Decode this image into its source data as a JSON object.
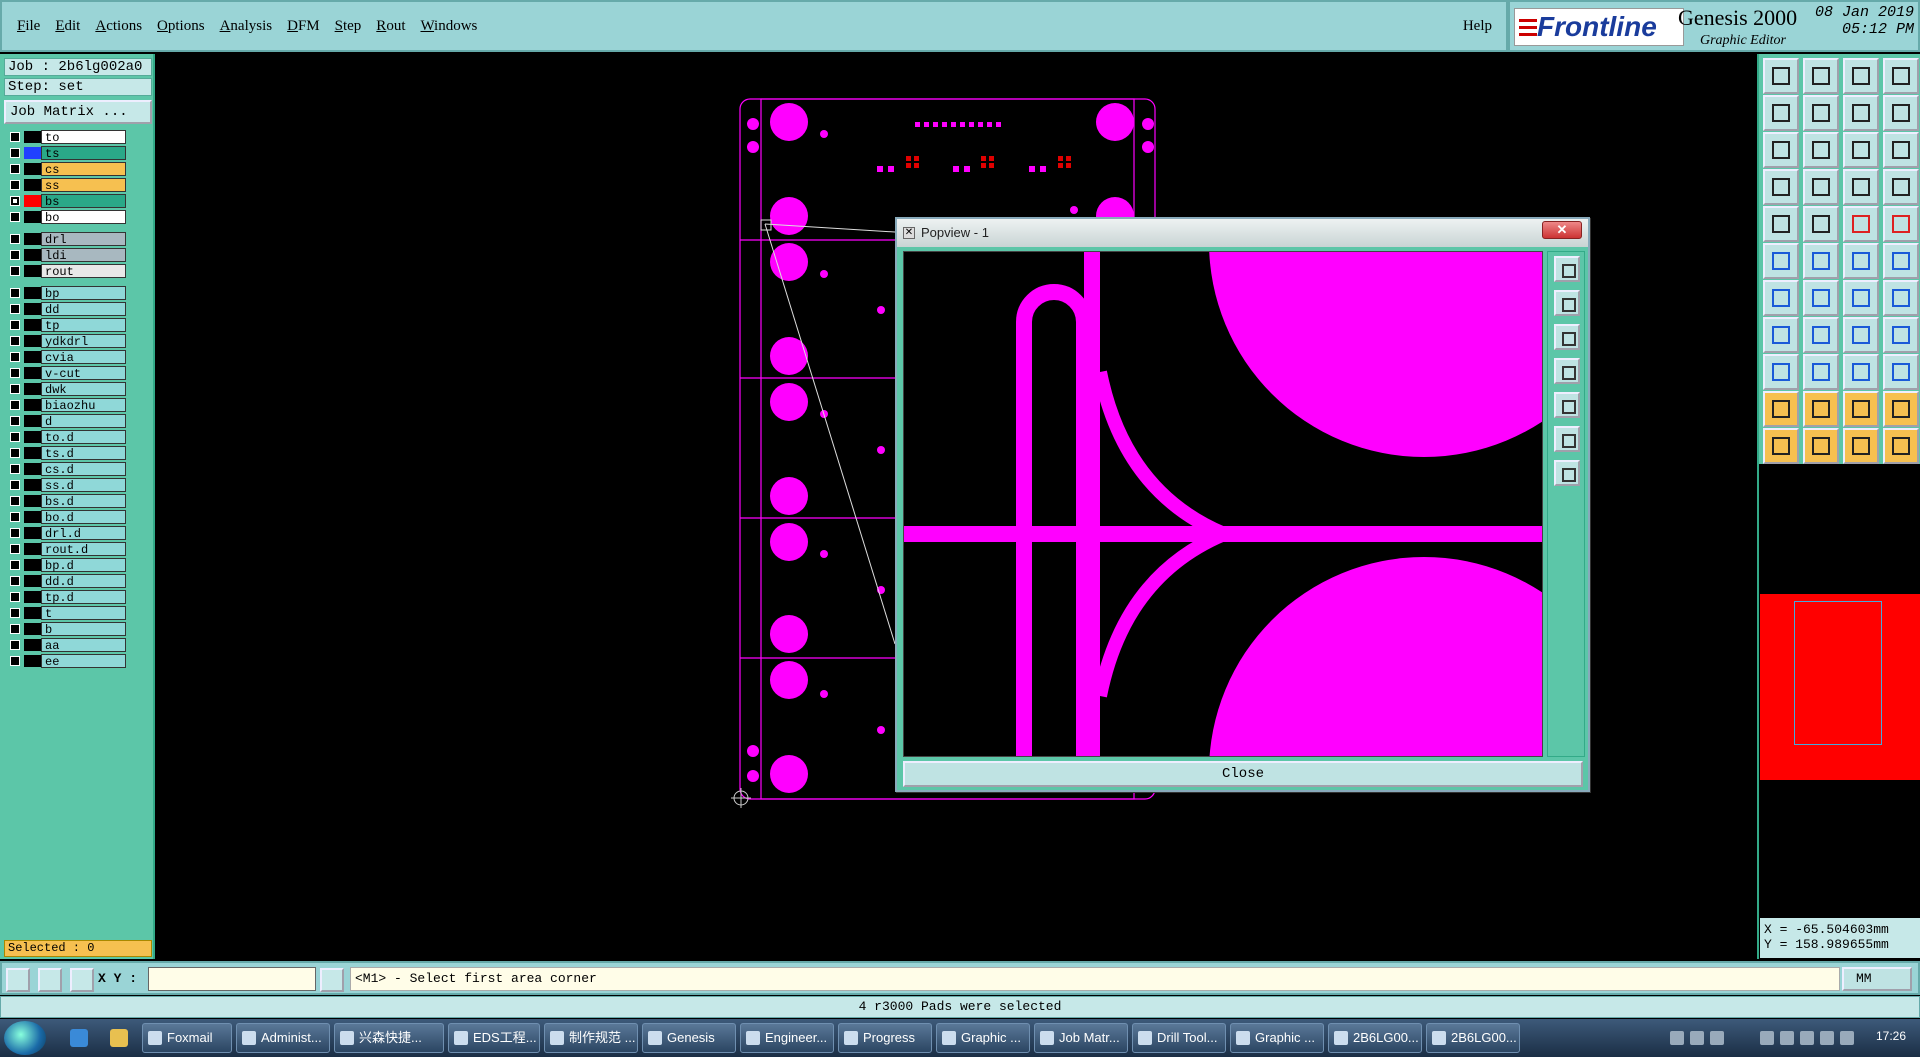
{
  "menu": {
    "items": [
      "File",
      "Edit",
      "Actions",
      "Options",
      "Analysis",
      "DFM",
      "Step",
      "Rout",
      "Windows"
    ],
    "help": "Help"
  },
  "brand": {
    "logo": "Frontline",
    "product": "Genesis 2000",
    "subtitle": "Graphic Editor",
    "date": "08 Jan 2019",
    "time": "05:12 PM"
  },
  "job": {
    "job_label": "Job : 2b6lg002a0",
    "step_label": "Step: set",
    "matrix_button": "Job Matrix ..."
  },
  "layers": [
    {
      "name": "to",
      "bg": "#ffffff",
      "swatch": "#000000",
      "checked": false
    },
    {
      "name": "ts",
      "bg": "#2aa888",
      "swatch": "#2040ff",
      "checked": false
    },
    {
      "name": "cs",
      "bg": "#f6c050",
      "swatch": "#000000",
      "checked": false
    },
    {
      "name": "ss",
      "bg": "#f6c050",
      "swatch": "#000000",
      "checked": false
    },
    {
      "name": "bs",
      "bg": "#2aa888",
      "swatch": "#ff0000",
      "checked": true
    },
    {
      "name": "bo",
      "bg": "#ffffff",
      "swatch": "#000000",
      "checked": false
    },
    {
      "name": "drl",
      "bg": "#a8b8c0",
      "swatch": "#000000",
      "checked": false
    },
    {
      "name": "ldi",
      "bg": "#a8b8c0",
      "swatch": "#000000",
      "checked": false
    },
    {
      "name": "rout",
      "bg": "#e8e8e8",
      "swatch": "#000000",
      "checked": false
    },
    {
      "name": "bp",
      "bg": "#8fd8d8",
      "swatch": "#000000",
      "checked": false
    },
    {
      "name": "dd",
      "bg": "#8fd8d8",
      "swatch": "#000000",
      "checked": false
    },
    {
      "name": "tp",
      "bg": "#8fd8d8",
      "swatch": "#000000",
      "checked": false
    },
    {
      "name": "ydkdrl",
      "bg": "#8fd8d8",
      "swatch": "#000000",
      "checked": false
    },
    {
      "name": "cvia",
      "bg": "#8fd8d8",
      "swatch": "#000000",
      "checked": false
    },
    {
      "name": "v-cut",
      "bg": "#8fd8d8",
      "swatch": "#000000",
      "checked": false
    },
    {
      "name": "dwk",
      "bg": "#8fd8d8",
      "swatch": "#000000",
      "checked": false
    },
    {
      "name": "biaozhu",
      "bg": "#8fd8d8",
      "swatch": "#000000",
      "checked": false
    },
    {
      "name": "d",
      "bg": "#8fd8d8",
      "swatch": "#000000",
      "checked": false
    },
    {
      "name": "to.d",
      "bg": "#8fd8d8",
      "swatch": "#000000",
      "checked": false
    },
    {
      "name": "ts.d",
      "bg": "#8fd8d8",
      "swatch": "#000000",
      "checked": false
    },
    {
      "name": "cs.d",
      "bg": "#8fd8d8",
      "swatch": "#000000",
      "checked": false
    },
    {
      "name": "ss.d",
      "bg": "#8fd8d8",
      "swatch": "#000000",
      "checked": false
    },
    {
      "name": "bs.d",
      "bg": "#8fd8d8",
      "swatch": "#000000",
      "checked": false
    },
    {
      "name": "bo.d",
      "bg": "#8fd8d8",
      "swatch": "#000000",
      "checked": false
    },
    {
      "name": "drl.d",
      "bg": "#8fd8d8",
      "swatch": "#000000",
      "checked": false
    },
    {
      "name": "rout.d",
      "bg": "#8fd8d8",
      "swatch": "#000000",
      "checked": false
    },
    {
      "name": "bp.d",
      "bg": "#8fd8d8",
      "swatch": "#000000",
      "checked": false
    },
    {
      "name": "dd.d",
      "bg": "#8fd8d8",
      "swatch": "#000000",
      "checked": false
    },
    {
      "name": "tp.d",
      "bg": "#8fd8d8",
      "swatch": "#000000",
      "checked": false
    },
    {
      "name": "t",
      "bg": "#8fd8d8",
      "swatch": "#000000",
      "checked": false
    },
    {
      "name": "b",
      "bg": "#8fd8d8",
      "swatch": "#000000",
      "checked": false
    },
    {
      "name": "aa",
      "bg": "#8fd8d8",
      "swatch": "#000000",
      "checked": false
    },
    {
      "name": "ee",
      "bg": "#8fd8d8",
      "swatch": "#000000",
      "checked": false
    }
  ],
  "selected_label": "Selected : 0",
  "popview": {
    "title": "Popview - 1",
    "close_label": "Close"
  },
  "coords": {
    "x": "X = -65.504603mm",
    "y": "Y = 158.989655mm"
  },
  "status": {
    "xy_label": "X Y :",
    "xy_value": "",
    "prompt": "<M1> - Select first area corner",
    "units": "MM",
    "message": "4 r3000 Pads were selected"
  },
  "taskbar": {
    "items": [
      "Foxmail",
      "Administ...",
      "兴森快捷...",
      "EDS工程...",
      "制作规范 ...",
      "Genesis",
      "Engineer...",
      "Progress",
      "Graphic ...",
      "Job Matr...",
      "Drill Tool...",
      "Graphic ...",
      "2B6LG00...",
      "2B6LG00..."
    ],
    "clock": "17:26"
  },
  "colors": {
    "panel": "#5cc6a8",
    "menubar": "#9ad4d6",
    "feature": "#ff00ff",
    "minimap": "#ff0000"
  }
}
